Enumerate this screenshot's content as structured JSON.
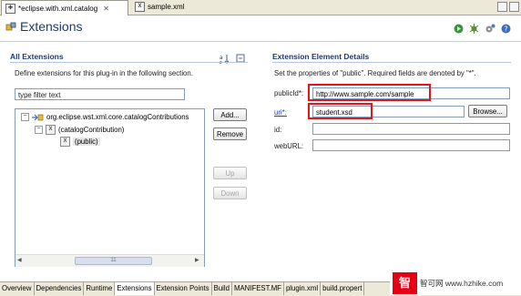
{
  "editor_tabs": [
    {
      "label": "*eclipse.with.xml.catalog",
      "active": true
    },
    {
      "label": "sample.xml",
      "active": false
    }
  ],
  "header": {
    "title": "Extensions"
  },
  "all_extensions": {
    "title": "All Extensions",
    "description": "Define extensions for this plug-in in the following section.",
    "filter_placeholder": "type filter text",
    "tree": {
      "root": "org.eclipse.wst.xml.core.catalogContributions",
      "child": "(catalogContribution)",
      "grandchild": "(public)"
    },
    "buttons": {
      "add": "Add...",
      "remove": "Remove",
      "up": "Up",
      "down": "Down"
    },
    "scroll_value": "11"
  },
  "details": {
    "title": "Extension Element Details",
    "description": "Set the properties of \"public\". Required fields are denoted by \"*\".",
    "fields": {
      "publicId_label": "publicId*:",
      "publicId_value": "http://www.sample.com/sample",
      "uri_label": "uri*:",
      "uri_value": "student.xsd",
      "browse": "Browse...",
      "id_label": "id:",
      "id_value": "",
      "webURL_label": "webURL:",
      "webURL_value": ""
    }
  },
  "bottom_tabs": [
    "Overview",
    "Dependencies",
    "Runtime",
    "Extensions",
    "Extension Points",
    "Build",
    "MANIFEST.MF",
    "plugin.xml",
    "build.propert"
  ],
  "active_bottom_tab": "Extensions",
  "watermark": {
    "logo": "智",
    "text": "智可网 www.hzhike.com"
  },
  "colors": {
    "title": "#1f3a6e",
    "highlight": "#e0161b",
    "watermark": "#e60012"
  }
}
